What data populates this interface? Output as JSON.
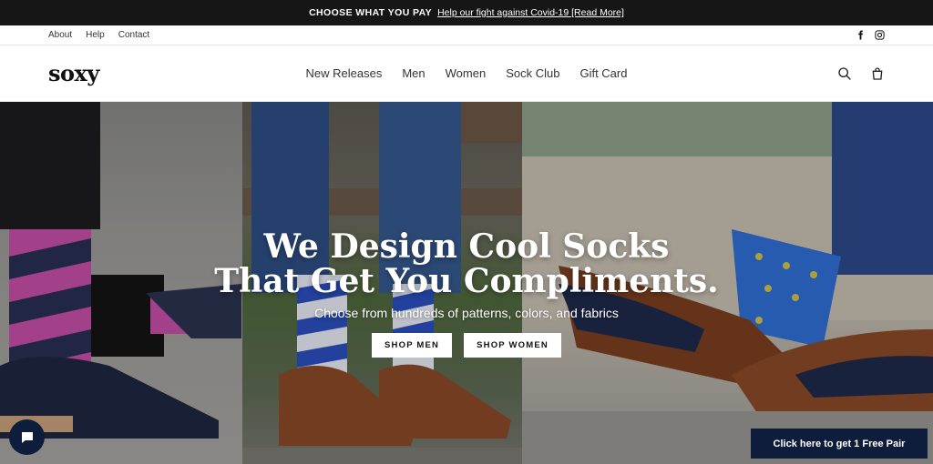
{
  "announcement": {
    "bold": "CHOOSE WHAT YOU PAY",
    "link": "Help our fight against Covid-19 [Read More]"
  },
  "utility": {
    "links": [
      "About",
      "Help",
      "Contact"
    ],
    "social": [
      "facebook-icon",
      "instagram-icon"
    ]
  },
  "header": {
    "logo": "soxy",
    "nav": [
      "New Releases",
      "Men",
      "Women",
      "Sock Club",
      "Gift Card"
    ],
    "icons": [
      "search-icon",
      "cart-icon"
    ]
  },
  "hero": {
    "headline_line1": "We Design Cool Socks",
    "headline_line2": "That Get You Compliments.",
    "subtext": "Choose from hundreds of patterns, colors, and fabrics",
    "buttons": [
      "SHOP MEN",
      "SHOP WOMEN"
    ]
  },
  "widgets": {
    "chat_icon": "chat-bubble-icon",
    "free_pair": "Click here to get 1 Free Pair"
  },
  "colors": {
    "announcement_bg": "#161616",
    "navy": "#0e1d3b"
  }
}
